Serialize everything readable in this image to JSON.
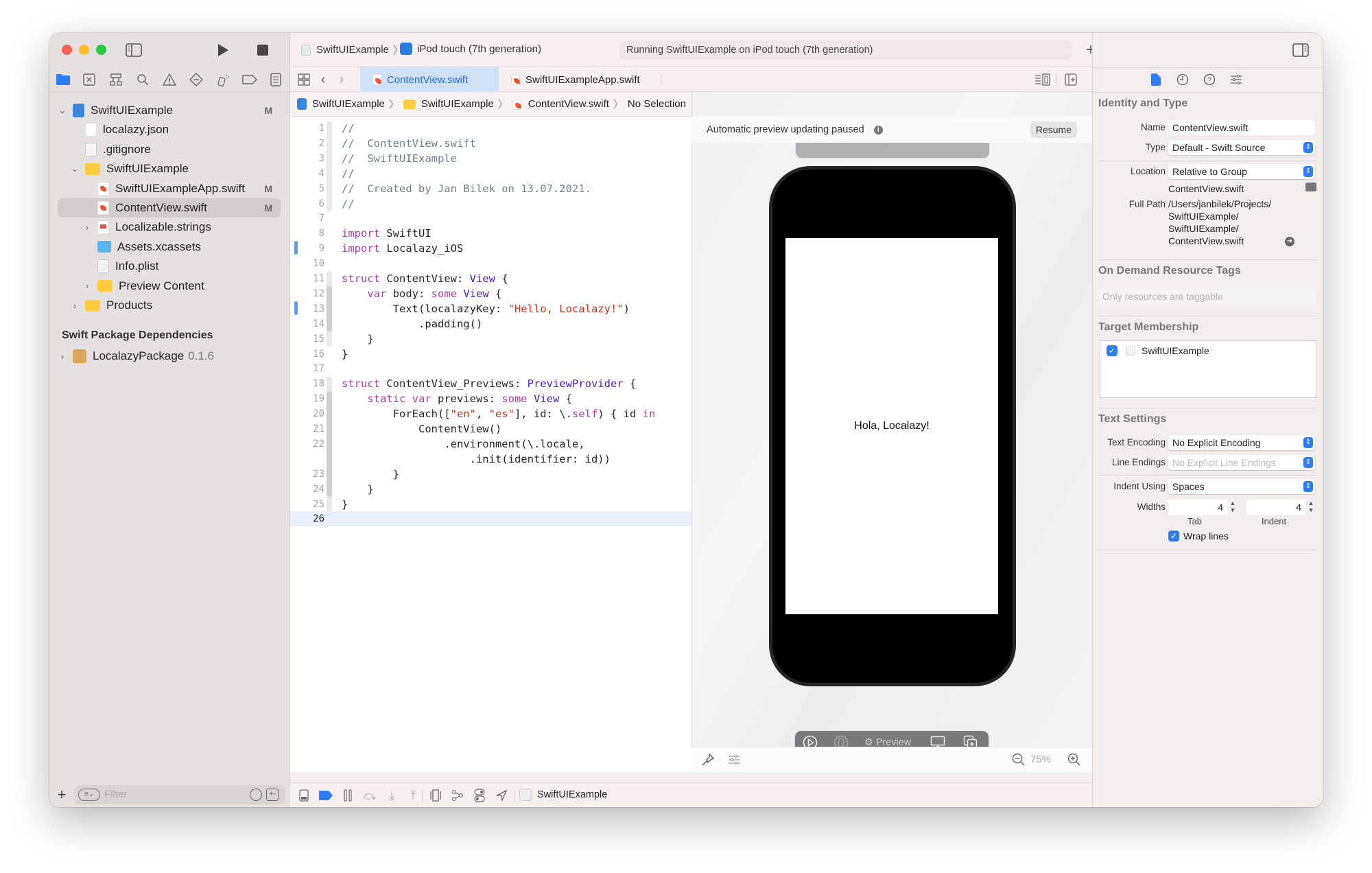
{
  "window": {
    "traffic_lights": {
      "close": "#ff5f57",
      "minimize": "#febc2e",
      "zoom": "#28c840"
    },
    "accent": "#2f7cf6"
  },
  "toolbar": {
    "scheme": "SwiftUIExample",
    "destination": "iPod touch (7th generation)",
    "activity": "Running SwiftUIExample on iPod touch (7th generation)",
    "icons": [
      "sidebar-toggle-icon",
      "run-icon",
      "stop-icon",
      "add-icon",
      "code-review-icon",
      "inspector-toggle-icon"
    ]
  },
  "navigator": {
    "icons": [
      "folder-icon",
      "source-control-icon",
      "symbol-icon",
      "search-icon",
      "issue-icon",
      "test-icon",
      "debug-icon",
      "breakpoint-icon",
      "report-icon"
    ],
    "tree": [
      {
        "label": "SwiftUIExample",
        "icon": "project",
        "level": 0,
        "disclosure": "open",
        "badge": "M"
      },
      {
        "label": "localazy.json",
        "icon": "json",
        "level": 1,
        "disclosure": "",
        "badge": ""
      },
      {
        "label": ".gitignore",
        "icon": "doc",
        "level": 1,
        "disclosure": "",
        "badge": ""
      },
      {
        "label": "SwiftUIExample",
        "icon": "folder",
        "level": 1,
        "disclosure": "open",
        "badge": ""
      },
      {
        "label": "SwiftUIExampleApp.swift",
        "icon": "swift",
        "level": 2,
        "disclosure": "",
        "badge": "M"
      },
      {
        "label": "ContentView.swift",
        "icon": "swift",
        "level": 2,
        "disclosure": "",
        "badge": "M",
        "selected": true
      },
      {
        "label": "Localizable.strings",
        "icon": "strings",
        "level": 2,
        "disclosure": "closed",
        "badge": ""
      },
      {
        "label": "Assets.xcassets",
        "icon": "assets",
        "level": 2,
        "disclosure": "",
        "badge": ""
      },
      {
        "label": "Info.plist",
        "icon": "plist",
        "level": 2,
        "disclosure": "",
        "badge": ""
      },
      {
        "label": "Preview Content",
        "icon": "folder",
        "level": 2,
        "disclosure": "closed",
        "badge": ""
      },
      {
        "label": "Products",
        "icon": "folder",
        "level": 1,
        "disclosure": "closed",
        "badge": ""
      }
    ],
    "packages_title": "Swift Package Dependencies",
    "package": {
      "name": "LocalazyPackage",
      "version": "0.1.6"
    },
    "filter_placeholder": "Filter"
  },
  "editor": {
    "tabs": [
      {
        "label": "ContentView.swift",
        "active": true
      },
      {
        "label": "SwiftUIExampleApp.swift",
        "active": false
      }
    ],
    "breadcrumb": [
      "SwiftUIExample",
      "SwiftUIExample",
      "ContentView.swift",
      "No Selection"
    ],
    "current_line": 26,
    "lines": [
      {
        "n": "1",
        "tokens": [
          [
            "c-com",
            "//"
          ]
        ]
      },
      {
        "n": "2",
        "tokens": [
          [
            "c-com",
            "//  ContentView.swift"
          ]
        ]
      },
      {
        "n": "3",
        "tokens": [
          [
            "c-com",
            "//  SwiftUIExample"
          ]
        ]
      },
      {
        "n": "4",
        "tokens": [
          [
            "c-com",
            "//"
          ]
        ]
      },
      {
        "n": "5",
        "tokens": [
          [
            "c-com",
            "//  Created by Jan Bilek on 13.07.2021."
          ]
        ]
      },
      {
        "n": "6",
        "tokens": [
          [
            "c-com",
            "//"
          ]
        ]
      },
      {
        "n": "7",
        "tokens": []
      },
      {
        "n": "8",
        "tokens": [
          [
            "c-kw",
            "import"
          ],
          [
            "",
            " SwiftUI"
          ]
        ]
      },
      {
        "n": "9",
        "tokens": [
          [
            "c-kw",
            "import"
          ],
          [
            "",
            " Localazy_iOS"
          ]
        ],
        "changed": true
      },
      {
        "n": "10",
        "tokens": []
      },
      {
        "n": "11",
        "tokens": [
          [
            "c-kw",
            "struct"
          ],
          [
            "",
            " ContentView: "
          ],
          [
            "c-type",
            "View"
          ],
          [
            "",
            " {"
          ]
        ]
      },
      {
        "n": "12",
        "tokens": [
          [
            "",
            "    "
          ],
          [
            "c-kw",
            "var"
          ],
          [
            "",
            " body: "
          ],
          [
            "c-kw",
            "some"
          ],
          [
            "",
            " "
          ],
          [
            "c-type",
            "View"
          ],
          [
            "",
            " {"
          ]
        ]
      },
      {
        "n": "13",
        "tokens": [
          [
            "",
            "        Text(localazyKey: "
          ],
          [
            "c-str",
            "\"Hello, Localazy!\""
          ],
          [
            "",
            ")"
          ]
        ],
        "changed": true
      },
      {
        "n": "14",
        "tokens": [
          [
            "",
            "            .padding()"
          ]
        ]
      },
      {
        "n": "15",
        "tokens": [
          [
            "",
            "    }"
          ]
        ]
      },
      {
        "n": "16",
        "tokens": [
          [
            "",
            "}"
          ]
        ]
      },
      {
        "n": "17",
        "tokens": []
      },
      {
        "n": "18",
        "tokens": [
          [
            "c-kw",
            "struct"
          ],
          [
            "",
            " ContentView_Previews: "
          ],
          [
            "c-type",
            "PreviewProvider"
          ],
          [
            "",
            " {"
          ]
        ]
      },
      {
        "n": "19",
        "tokens": [
          [
            "",
            "    "
          ],
          [
            "c-kw",
            "static var"
          ],
          [
            "",
            " previews: "
          ],
          [
            "c-kw",
            "some"
          ],
          [
            "",
            " "
          ],
          [
            "c-type",
            "View"
          ],
          [
            "",
            " {"
          ]
        ]
      },
      {
        "n": "20",
        "tokens": [
          [
            "",
            "        ForEach(["
          ],
          [
            "c-str",
            "\"en\""
          ],
          [
            "",
            ", "
          ],
          [
            "c-str",
            "\"es\""
          ],
          [
            "",
            "], id: \\."
          ],
          [
            "c-kw",
            "self"
          ],
          [
            "",
            ") { id "
          ],
          [
            "c-kw",
            "in"
          ]
        ]
      },
      {
        "n": "21",
        "tokens": [
          [
            "",
            "            ContentView()"
          ]
        ]
      },
      {
        "n": "22",
        "tokens": [
          [
            "",
            "                .environment(\\.locale,"
          ]
        ]
      },
      {
        "n": "",
        "tokens": [
          [
            "",
            "                    .init(identifier: id))"
          ]
        ]
      },
      {
        "n": "23",
        "tokens": [
          [
            "",
            "        }"
          ]
        ]
      },
      {
        "n": "24",
        "tokens": [
          [
            "",
            "    }"
          ]
        ]
      },
      {
        "n": "25",
        "tokens": [
          [
            "",
            "}"
          ]
        ]
      },
      {
        "n": "26",
        "tokens": []
      }
    ]
  },
  "canvas": {
    "status": "Automatic preview updating paused",
    "resume_label": "Resume",
    "preview_label": "Preview",
    "preview_text": "Hola, Localazy!",
    "zoom": "75%"
  },
  "debug_bar": {
    "target": "SwiftUIExample"
  },
  "inspector": {
    "tab_icons": [
      "file-icon",
      "history-icon",
      "help-icon",
      "attributes-icon"
    ],
    "identity": {
      "title": "Identity and Type",
      "name_label": "Name",
      "name_value": "ContentView.swift",
      "type_label": "Type",
      "type_value": "Default - Swift Source",
      "location_label": "Location",
      "location_value": "Relative to Group",
      "location_file": "ContentView.swift",
      "full_path_label": "Full Path",
      "full_path_lines": [
        "/Users/janbilek/Projects/",
        "SwiftUIExample/",
        "SwiftUIExample/",
        "ContentView.swift"
      ]
    },
    "odr": {
      "title": "On Demand Resource Tags",
      "placeholder": "Only resources are taggable"
    },
    "membership": {
      "title": "Target Membership",
      "targets": [
        {
          "name": "SwiftUIExample",
          "checked": true
        }
      ]
    },
    "text_settings": {
      "title": "Text Settings",
      "encoding_label": "Text Encoding",
      "encoding_value": "No Explicit Encoding",
      "line_endings_label": "Line Endings",
      "line_endings_value": "No Explicit Line Endings",
      "indent_label": "Indent Using",
      "indent_value": "Spaces",
      "widths_label": "Widths",
      "tab_value": "4",
      "indent_width_value": "4",
      "tab_caption": "Tab",
      "indent_caption": "Indent",
      "wrap_label": "Wrap lines",
      "wrap_checked": true
    }
  }
}
